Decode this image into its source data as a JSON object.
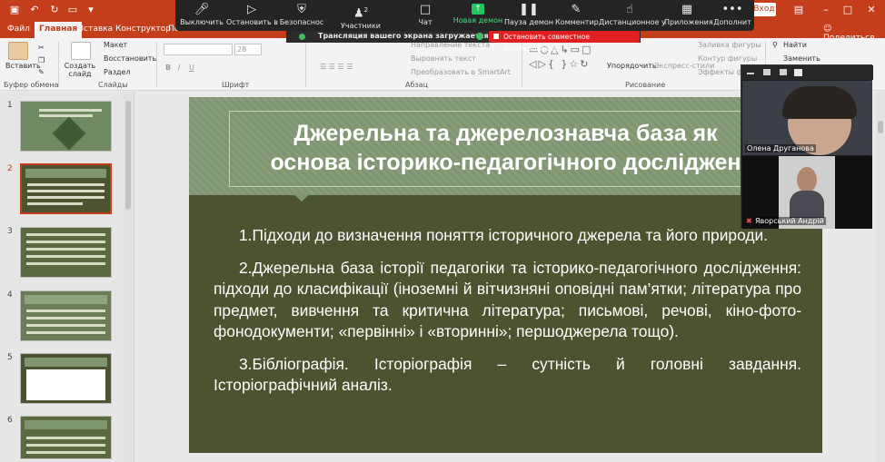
{
  "window": {
    "signin_label": "Вход",
    "share_label": "Поделиться"
  },
  "ribbon_tabs": [
    "Файл",
    "Главная",
    "Вставка",
    "Конструктор",
    "Пе"
  ],
  "ribbon": {
    "insert_label": "Вставить",
    "clipboard_group": "Буфер обмена",
    "new_slide": "Создать слайд",
    "layout": "Макет",
    "reset": "Восстановить",
    "section": "Раздел",
    "slides_group": "Слайды",
    "font_size": "28",
    "font_group": "Шрифт",
    "paragraph_group": "Абзац",
    "text_direction": "Направление текста",
    "align_text": "Выровнять текст",
    "convert_smartart": "Преобразовать в SmartArt",
    "arrange": "Упорядочить",
    "express_styles": "Экспресс-стили",
    "shape_fill": "Заливка фигуры",
    "shape_outline": "Контур фигуры",
    "shape_effects": "Эффекты фигу",
    "drawing_group": "Рисование",
    "find": "Найти",
    "replace": "Заменить"
  },
  "zoom_toolbar": {
    "items": [
      {
        "label": "Выключить",
        "icon": "microphone-icon"
      },
      {
        "label": "Остановить в",
        "icon": "video-camera-icon"
      },
      {
        "label": "Безопаснос",
        "icon": "shield-icon"
      },
      {
        "label": "Участники",
        "icon": "participants-icon",
        "badge": "2"
      },
      {
        "label": "Чат",
        "icon": "chat-icon"
      },
      {
        "label": "Новая демон",
        "icon": "share-screen-icon"
      },
      {
        "label": "Пауза демон",
        "icon": "pause-icon"
      },
      {
        "label": "Комментир",
        "icon": "pencil-icon"
      },
      {
        "label": "Дистанционное у",
        "icon": "remote-control-icon"
      },
      {
        "label": "Приложения",
        "icon": "apps-icon"
      },
      {
        "label": "Дополнит",
        "icon": "more-icon"
      }
    ],
    "banner_text": "Трансляция вашего экрана загружается",
    "stop_label": "Остановить совместное использование"
  },
  "thumbnails": [
    {
      "num": "1",
      "bg": "#6f8a62"
    },
    {
      "num": "2",
      "bg": "#4c5330",
      "active": true
    },
    {
      "num": "3",
      "bg": "#5b6b3f"
    },
    {
      "num": "4",
      "bg": "#6a7d56"
    },
    {
      "num": "5",
      "bg": "#4c5330"
    },
    {
      "num": "6",
      "bg": "#5b6b3f"
    }
  ],
  "slide": {
    "title": "Джерельна та джерелознавча база як\nоснова історико-педагогічного досліджен",
    "paragraphs": [
      "1.Підходи до визначення поняття історичного джерела та його природи.",
      "2.Джерельна база історії педагогіки та історико-педагогічного дослідження: підходи до класифікації (іноземні й вітчизняні оповідні пам’ятки; література про предмет, вивчення та критична література; письмові, речові, кіно-фото-фонодокументи; «первінні» і «вторинні»; першоджерела тощо).",
      "3.Бібліографія. Історіографія – сутність й головні завдання. Історіографічний аналіз."
    ]
  },
  "video_panel": {
    "participants": [
      {
        "name": "Олена Друганова"
      },
      {
        "name": "Яворський Андрій",
        "muted": true
      }
    ]
  },
  "colors": {
    "accent": "#c43e1c",
    "slide_bg": "#4c5330",
    "slide_header": "#7e9570",
    "zoom_bar": "#242424",
    "share_green": "#22c55e",
    "stop_red": "#e02020"
  }
}
